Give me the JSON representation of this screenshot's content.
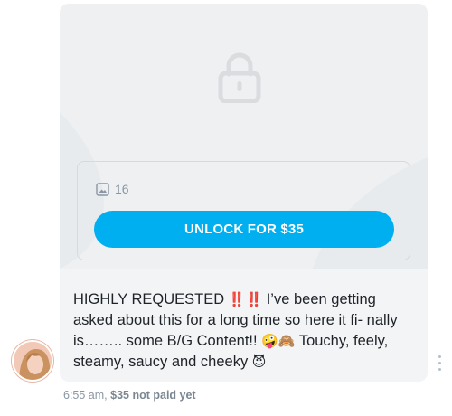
{
  "locked_post": {
    "media_count": "16",
    "unlock_label": "UNLOCK FOR $35"
  },
  "message": {
    "part1": "HIGHLY REQUESTED ",
    "em1": "‼️",
    "em2": "‼️",
    "part2": " I’ve been getting asked about this for a long time so here it fi- nally is…….. some B/G Content!! ",
    "em3": "🤪",
    "em4": "🙈",
    "part3": " Touchy, feely, steamy, saucy and cheeky ",
    "em5": "😈"
  },
  "meta": {
    "time": "6:55 am,",
    "paid_status": "$35 not paid yet"
  },
  "colors": {
    "accent": "#00aff0",
    "muted": "#8a96a3",
    "bubble": "#f2f4f5"
  },
  "icons": [
    "lock-icon",
    "image-icon",
    "more-options-icon"
  ]
}
